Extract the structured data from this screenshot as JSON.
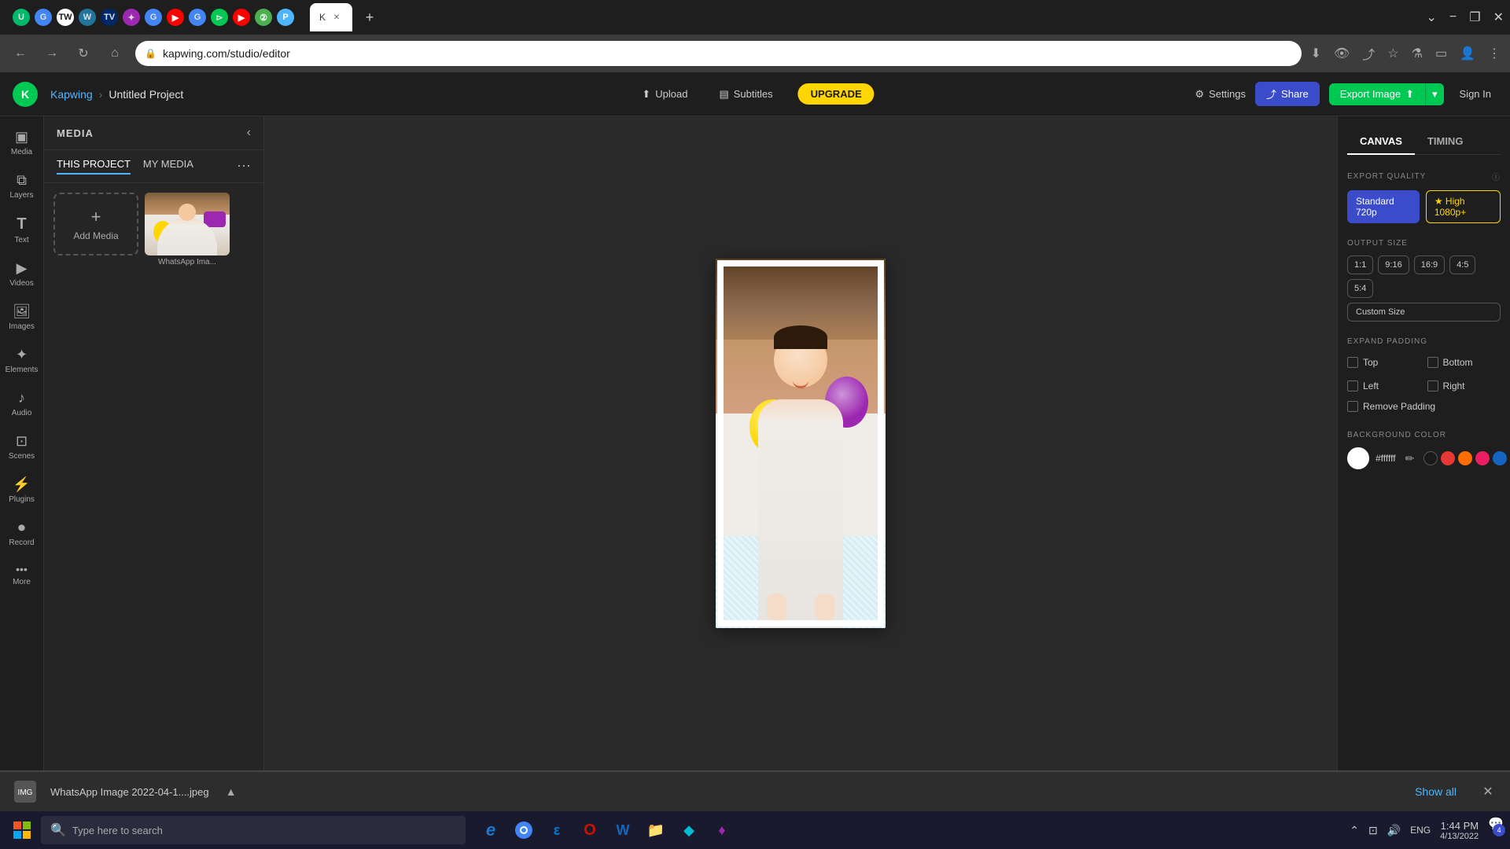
{
  "browser": {
    "url": "kapwing.com/studio/editor",
    "tab_title": "K",
    "new_tab_tooltip": "New tab",
    "nav": {
      "back": "←",
      "forward": "→",
      "refresh": "↻",
      "home": "⌂"
    }
  },
  "topbar": {
    "logo_letter": "K",
    "brand": "Kapwing",
    "separator": "›",
    "project_name": "Untitled Project",
    "upload_label": "Upload",
    "subtitles_label": "Subtitles",
    "upgrade_label": "UPGRADE",
    "settings_label": "Settings",
    "share_label": "Share",
    "export_label": "Export Image",
    "sign_in_label": "Sign In"
  },
  "sidebar": {
    "items": [
      {
        "id": "media",
        "label": "Media",
        "icon": "▣"
      },
      {
        "id": "layers",
        "label": "Layers",
        "icon": "⧉"
      },
      {
        "id": "text",
        "label": "Text",
        "icon": "T"
      },
      {
        "id": "videos",
        "label": "Videos",
        "icon": "▶"
      },
      {
        "id": "images",
        "label": "Images",
        "icon": "🖼"
      },
      {
        "id": "elements",
        "label": "Elements",
        "icon": "✦"
      },
      {
        "id": "audio",
        "label": "Audio",
        "icon": "♪"
      },
      {
        "id": "scenes",
        "label": "Scenes",
        "icon": "⊡"
      },
      {
        "id": "plugins",
        "label": "Plugins",
        "icon": "⚡"
      },
      {
        "id": "record",
        "label": "Record",
        "icon": "⏺"
      },
      {
        "id": "more",
        "label": "More",
        "icon": "•••"
      }
    ]
  },
  "media_panel": {
    "title": "MEDIA",
    "tabs": [
      {
        "id": "this_project",
        "label": "THIS PROJECT",
        "active": true
      },
      {
        "id": "my_media",
        "label": "MY MEDIA",
        "active": false
      }
    ],
    "add_media_label": "Add Media",
    "media_items": [
      {
        "id": "whatsapp_img",
        "label": "WhatsApp Ima..."
      }
    ]
  },
  "right_panel": {
    "tabs": [
      {
        "id": "canvas",
        "label": "CANVAS",
        "active": true
      },
      {
        "id": "timing",
        "label": "TIMING",
        "active": false
      }
    ],
    "export_quality": {
      "label": "EXPORT QUALITY",
      "options": [
        {
          "id": "standard",
          "label": "Standard 720p",
          "active": true
        },
        {
          "id": "high",
          "label": "★ High 1080p+",
          "active": false,
          "gold": true
        }
      ]
    },
    "output_size": {
      "label": "OUTPUT SIZE",
      "options": [
        {
          "id": "1:1",
          "label": "1:1"
        },
        {
          "id": "9:16",
          "label": "9:16"
        },
        {
          "id": "16:9",
          "label": "16:9"
        },
        {
          "id": "4:5",
          "label": "4:5"
        },
        {
          "id": "5:4",
          "label": "5:4"
        },
        {
          "id": "custom",
          "label": "Custom Size"
        }
      ]
    },
    "expand_padding": {
      "label": "EXPAND PADDING",
      "options": [
        {
          "id": "top",
          "label": "Top"
        },
        {
          "id": "bottom",
          "label": "Bottom"
        },
        {
          "id": "left",
          "label": "Left"
        },
        {
          "id": "right",
          "label": "Right"
        }
      ],
      "remove_padding_label": "Remove Padding"
    },
    "background_color": {
      "label": "BACKGROUND COLOR",
      "current_hex": "#ffffff",
      "swatches": [
        {
          "id": "white",
          "color": "#ffffff"
        },
        {
          "id": "black",
          "color": "#1a1a1a"
        },
        {
          "id": "red",
          "color": "#e53935"
        },
        {
          "id": "orange",
          "color": "#ff6d00"
        },
        {
          "id": "pink",
          "color": "#e91e63"
        },
        {
          "id": "blue",
          "color": "#1565c0"
        },
        {
          "id": "gradient",
          "color": "conic-gradient(red,yellow,green,blue,red)"
        }
      ]
    }
  },
  "bottom_bar": {
    "filename": "WhatsApp Image 2022-04-1....jpeg",
    "show_all_label": "Show all",
    "close_label": "✕"
  },
  "taskbar": {
    "search_placeholder": "Type here to search",
    "apps": [
      {
        "id": "ie",
        "icon": "e",
        "color": "#1976d2"
      },
      {
        "id": "chrome",
        "icon": "◉",
        "color": "#4caf50"
      },
      {
        "id": "edge",
        "icon": "ε",
        "color": "#0078d4"
      },
      {
        "id": "opera",
        "icon": "O",
        "color": "#cc1100"
      },
      {
        "id": "word",
        "icon": "W",
        "color": "#1565c0"
      },
      {
        "id": "explorer",
        "icon": "📁",
        "color": "#ffd600"
      },
      {
        "id": "app7",
        "icon": "◆",
        "color": "#00bcd4"
      },
      {
        "id": "app8",
        "icon": "♦",
        "color": "#9c27b0"
      }
    ],
    "time": "1:44 PM",
    "date": "4/13/2022",
    "lang": "ENG",
    "notification_count": "4"
  }
}
